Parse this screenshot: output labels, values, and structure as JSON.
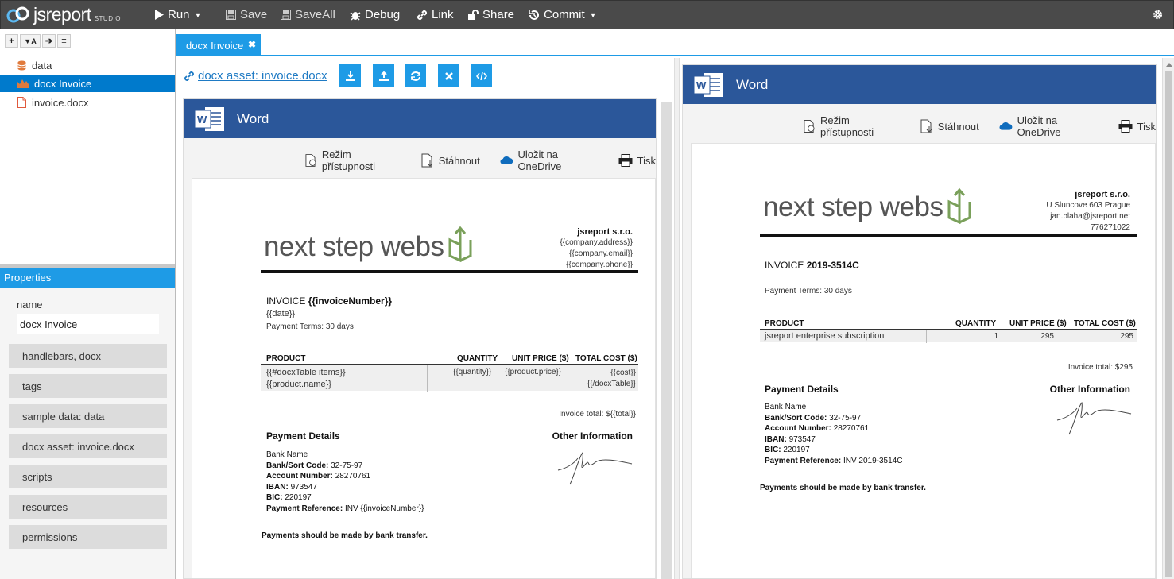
{
  "app": {
    "logo_text": "jsreport",
    "logo_sub": "STUDIO"
  },
  "toolbar": {
    "run": "Run",
    "save": "Save",
    "saveall": "SaveAll",
    "debug": "Debug",
    "link": "Link",
    "share": "Share",
    "commit": "Commit"
  },
  "tree": {
    "items": [
      {
        "label": "data",
        "icon": "database-icon"
      },
      {
        "label": "docx Invoice",
        "icon": "chart-icon"
      },
      {
        "label": "invoice.docx",
        "icon": "file-icon"
      }
    ]
  },
  "properties": {
    "header": "Properties",
    "name_label": "name",
    "name_value": "docx Invoice",
    "sections": [
      "handlebars, docx",
      "tags",
      "sample data: data",
      "docx asset: invoice.docx",
      "scripts",
      "resources",
      "permissions"
    ]
  },
  "tab": {
    "label": "docx Invoice"
  },
  "editor": {
    "asset_link": "docx asset: invoice.docx"
  },
  "word": {
    "title": "Word",
    "tools": [
      "Režim přístupnosti",
      "Stáhnout",
      "Uložit na OneDrive",
      "Tisk"
    ]
  },
  "template_doc": {
    "brand": "next step webs",
    "company_name": "jsreport s.r.o.",
    "company_lines": [
      "{{company.address}}",
      "{{company.email}}",
      "{{company.phone}}"
    ],
    "invoice_label": "INVOICE",
    "invoice_number": "{{invoiceNumber}}",
    "date": "{{date}}",
    "payment_terms": "Payment Terms: 30 days",
    "columns": [
      "PRODUCT",
      "QUANTITY",
      "UNIT PRICE ($)",
      "TOTAL COST ($)"
    ],
    "row": [
      "{{#docxTable items}}{{product.name}}",
      "{{quantity}}",
      "{{product.price}}",
      "{{cost}}{{/docxTable}}"
    ],
    "total": "Invoice total: ${{total}}",
    "payment_details": "Payment Details",
    "other_info": "Other Information",
    "bank_name": "Bank Name",
    "bank_code_label": "Bank/Sort Code:",
    "bank_code": "32-75-97",
    "account_label": "Account Number:",
    "account": "28270761",
    "iban_label": "IBAN:",
    "iban": "973547",
    "bic_label": "BIC:",
    "bic": "220197",
    "ref_label": "Payment Reference:",
    "ref": "INV {{invoiceNumber}}",
    "footer": "Payments should be made by bank transfer."
  },
  "preview_doc": {
    "brand": "next step webs",
    "company_name": "jsreport s.r.o.",
    "company_lines": [
      "U Sluncove 603 Prague",
      "jan.blaha@jsreport.net",
      "776271022"
    ],
    "invoice_label": "INVOICE",
    "invoice_number": "2019-3514C",
    "payment_terms": "Payment Terms: 30 days",
    "columns": [
      "PRODUCT",
      "QUANTITY",
      "UNIT PRICE ($)",
      "TOTAL COST ($)"
    ],
    "row": [
      "jsreport enterprise subscription",
      "1",
      "295",
      "295"
    ],
    "total": "Invoice total: $295",
    "payment_details": "Payment Details",
    "other_info": "Other Information",
    "bank_name": "Bank Name",
    "bank_code_label": "Bank/Sort Code:",
    "bank_code": "32-75-97",
    "account_label": "Account Number:",
    "account": "28270761",
    "iban_label": "IBAN:",
    "iban": "973547",
    "bic_label": "BIC:",
    "bic": "220197",
    "ref_label": "Payment Reference:",
    "ref": "INV 2019-3514C",
    "footer": "Payments should be made by bank transfer."
  },
  "colors": {
    "accent": "#1e9be6",
    "selected": "#007acc",
    "word_blue": "#2b579a",
    "topbar": "#4a4a4a",
    "leaf_green": "#7aa05a"
  }
}
